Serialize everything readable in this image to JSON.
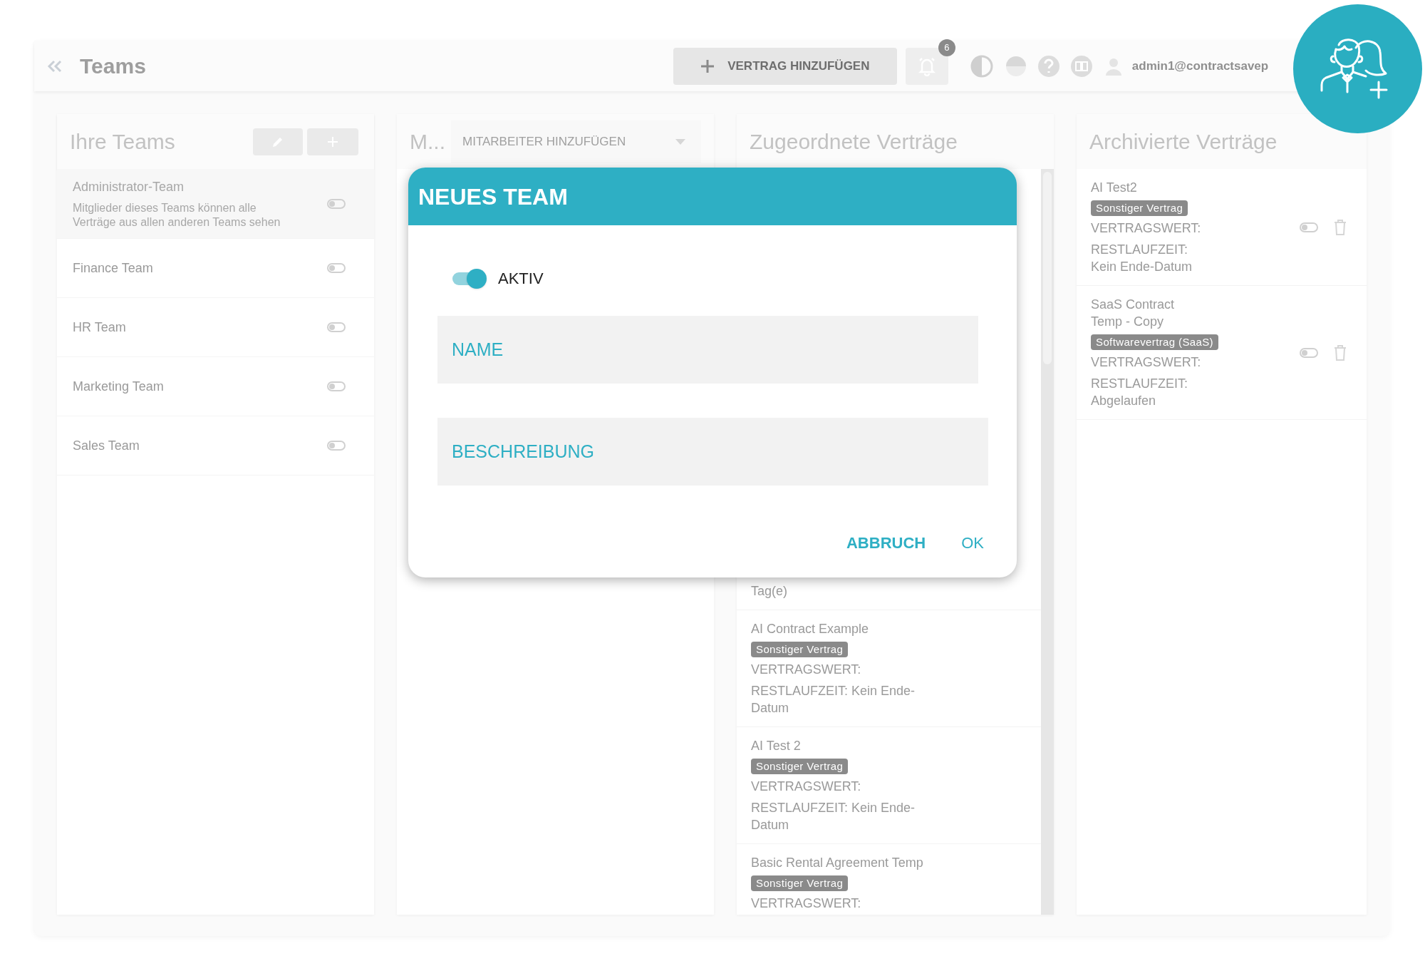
{
  "header": {
    "title": "Teams",
    "add_contract_button": "VERTRAG HINZUFÜGEN",
    "notification_count": "6",
    "user_email": "admin1@contractsavep"
  },
  "teams_panel": {
    "title": "Ihre Teams",
    "teams": [
      {
        "name": "Administrator-Team",
        "description": "Mitglieder dieses Teams können alle Verträge aus allen anderen Teams sehen",
        "on": false,
        "selected": true
      },
      {
        "name": "Finance Team",
        "on": false,
        "selected": false
      },
      {
        "name": "HR Team",
        "on": false,
        "selected": false
      },
      {
        "name": "Marketing Team",
        "on": false,
        "selected": false
      },
      {
        "name": "Sales Team",
        "on": false,
        "selected": false
      }
    ]
  },
  "members_panel": {
    "title": "M...",
    "add_member_placeholder": "MITARBEITER HINZUFÜGEN"
  },
  "assigned_panel": {
    "title": "Zugeordnete Verträge",
    "contracts": [
      {
        "remaining": "Tag(e)"
      },
      {
        "name": "AI Contract Example",
        "tag": "Sonstiger Vertrag",
        "value_label": "VERTRAGSWERT:",
        "remaining": "RESTLAUFZEIT: Kein Ende-Datum"
      },
      {
        "name": "AI Test 2",
        "tag": "Sonstiger Vertrag",
        "value_label": "VERTRAGSWERT:",
        "remaining": "RESTLAUFZEIT: Kein Ende-Datum"
      },
      {
        "name": "Basic Rental Agreement Temp",
        "tag": "Sonstiger Vertrag",
        "value_label": "VERTRAGSWERT:"
      }
    ]
  },
  "archived_panel": {
    "title": "Archivierte Verträge",
    "contracts": [
      {
        "name": "AI Test2",
        "tag": "Sonstiger Vertrag",
        "value_label": "VERTRAGSWERT:",
        "remaining": "RESTLAUFZEIT: Kein Ende-Datum",
        "on": false
      },
      {
        "name": "SaaS Contract Temp - Copy",
        "tag": "Softwarevertrag (SaaS)",
        "value_label": "VERTRAGSWERT:",
        "remaining": "RESTLAUFZEIT: Abgelaufen",
        "on": false
      }
    ]
  },
  "dialog": {
    "title": "NEUES TEAM",
    "active_label": "AKTIV",
    "active": true,
    "name_placeholder": "NAME",
    "description_placeholder": "BESCHREIBUNG",
    "buttons": [
      "ABBRUCH",
      "OK"
    ]
  }
}
